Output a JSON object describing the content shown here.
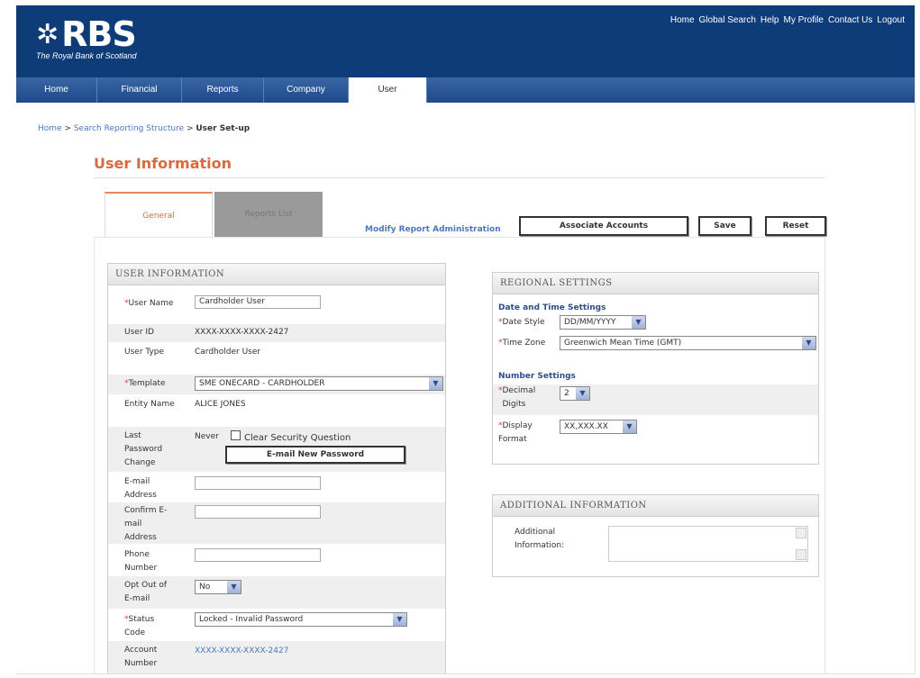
{
  "brand": {
    "name": "RBS",
    "tagline": "The Royal Bank of Scotland"
  },
  "top_links": [
    "Home",
    "Global Search",
    "Help",
    "My Profile",
    "Contact Us",
    "Logout"
  ],
  "nav": [
    "Home",
    "Financial",
    "Reports",
    "Company",
    "User"
  ],
  "nav_active": "User",
  "breadcrumb": {
    "home": "Home",
    "sep1": " > ",
    "search": "Search Reporting Structure",
    "sep2": " > ",
    "current": "User Set-up"
  },
  "page_title": "User Information",
  "tabs": {
    "general": "General",
    "reports_list": "Reports List"
  },
  "modify_link": "Modify Report Administration",
  "buttons": {
    "associate": "Associate Accounts",
    "save": "Save",
    "reset": "Reset"
  },
  "user_info": {
    "heading": "USER INFORMATION",
    "user_name_label": "User Name",
    "user_name_value": "Cardholder User",
    "user_id_label": "User ID",
    "user_id_value": "XXXX-XXXX-XXXX-2427",
    "user_type_label": "User Type",
    "user_type_value": "Cardholder User",
    "template_label": "Template",
    "template_value": "SME ONECARD - CARDHOLDER",
    "entity_label": "Entity Name",
    "entity_value": "ALICE JONES",
    "last_pwd_label": "Last Password Change",
    "last_pwd_value": "Never",
    "clear_security_label": "Clear Security Question",
    "email_pwd_button": "E-mail New Password",
    "email_label": "E-mail Address",
    "email_value": "",
    "confirm_email_label": "Confirm E-mail Address",
    "confirm_email_value": "",
    "phone_label": "Phone Number",
    "phone_value": "",
    "optout_label": "Opt Out of E-mail",
    "optout_value": "No",
    "status_label": "Status Code",
    "status_value": "Locked - Invalid Password",
    "account_label": "Account Number",
    "account_value": "XXXX-XXXX-XXXX-2427"
  },
  "regional": {
    "heading": "REGIONAL SETTINGS",
    "datetime_title": "Date and Time Settings",
    "date_style_label": "Date Style",
    "date_style_value": "DD/MM/YYYY",
    "time_zone_label": "Time Zone",
    "time_zone_value": "Greenwich Mean Time (GMT)",
    "number_title": "Number Settings",
    "decimal_label": "Decimal Digits",
    "decimal_value": "2",
    "display_label": "Display Format",
    "display_value": "XX,XXX.XX"
  },
  "additional": {
    "heading": "ADDITIONAL INFORMATION",
    "label": "Additional Information:",
    "value": ""
  },
  "colors": {
    "header_bg": "#0d3c78",
    "title": "#d76b40",
    "link": "#4a78c0",
    "required": "#d04a2a"
  }
}
